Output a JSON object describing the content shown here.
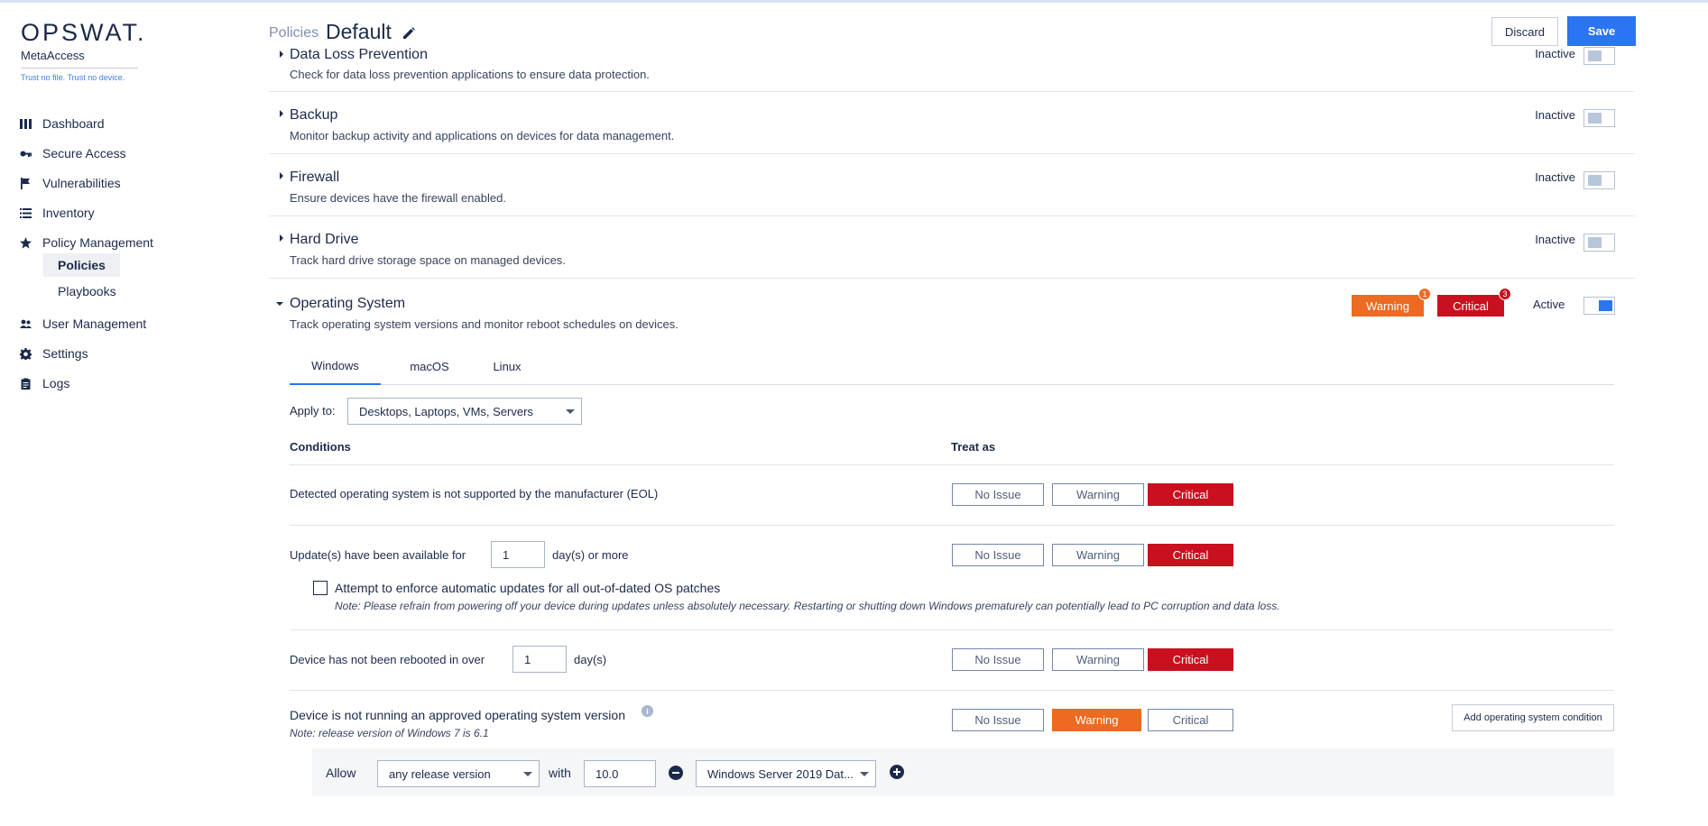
{
  "brand": {
    "logo": "OPSWAT.",
    "product": "MetaAccess",
    "tagline": "Trust no file. Trust no device."
  },
  "sidebar": {
    "items": [
      {
        "label": "Dashboard",
        "icon": "dashboard-icon"
      },
      {
        "label": "Secure Access",
        "icon": "key-icon"
      },
      {
        "label": "Vulnerabilities",
        "icon": "flag-icon"
      },
      {
        "label": "Inventory",
        "icon": "list-icon"
      },
      {
        "label": "Policy Management",
        "icon": "star-icon"
      },
      {
        "label": "User Management",
        "icon": "users-icon"
      },
      {
        "label": "Settings",
        "icon": "gear-icon"
      },
      {
        "label": "Logs",
        "icon": "clipboard-icon"
      }
    ],
    "sub_items": [
      {
        "label": "Policies",
        "active": true
      },
      {
        "label": "Playbooks",
        "active": false
      }
    ]
  },
  "header": {
    "breadcrumb": "Policies",
    "title": "Default",
    "discard_label": "Discard",
    "save_label": "Save"
  },
  "sections": [
    {
      "title": "Data Loss Prevention",
      "desc": "Check for data loss prevention applications to ensure data protection.",
      "status": "Inactive"
    },
    {
      "title": "Backup",
      "desc": "Monitor backup activity and applications on devices for data management.",
      "status": "Inactive"
    },
    {
      "title": "Firewall",
      "desc": "Ensure devices have the firewall enabled.",
      "status": "Inactive"
    },
    {
      "title": "Hard Drive",
      "desc": "Track hard drive storage space on managed devices.",
      "status": "Inactive"
    }
  ],
  "os_section": {
    "title": "Operating System",
    "desc": "Track operating system versions and monitor reboot schedules on devices.",
    "status": "Active",
    "warning_badge": {
      "label": "Warning",
      "count": "1"
    },
    "critical_badge": {
      "label": "Critical",
      "count": "3"
    },
    "tabs": [
      "Windows",
      "macOS",
      "Linux"
    ],
    "apply_to_label": "Apply to:",
    "apply_to_value": "Desktops, Laptops, VMs, Servers",
    "conditions_header": "Conditions",
    "treat_as_header": "Treat as",
    "severity_labels": {
      "no_issue": "No Issue",
      "warning": "Warning",
      "critical": "Critical"
    },
    "conditions": [
      {
        "text": "Detected operating system is not supported by the manufacturer (EOL)",
        "selected": "Critical"
      },
      {
        "text_before": "Update(s) have been available for",
        "value": "1",
        "text_after": "day(s) or more",
        "selected": "Critical"
      },
      {
        "text_before": "Device has not been rebooted in over",
        "value": "1",
        "text_after": "day(s)",
        "selected": "Critical"
      },
      {
        "text": "Device is not running an approved operating system version",
        "note": "Note: release version of Windows 7 is 6.1",
        "selected": "Warning"
      }
    ],
    "enforce_updates": {
      "label": "Attempt to enforce automatic updates for all out-of-dated OS patches",
      "note": "Note: Please refrain from powering off your device during updates unless absolutely necessary. Restarting or shutting down Windows prematurely can potentially lead to PC corruption and data loss.",
      "checked": false
    },
    "add_condition_label": "Add operating system condition",
    "allow_row": {
      "allow_label": "Allow",
      "release_select": "any release version",
      "with_label": "with",
      "version_value": "10.0",
      "os_select": "Windows Server 2019 Dat..."
    }
  },
  "colors": {
    "accent": "#2b74f2",
    "warning": "#ec6a21",
    "critical": "#c8101f",
    "text": "#1b2a4a"
  }
}
